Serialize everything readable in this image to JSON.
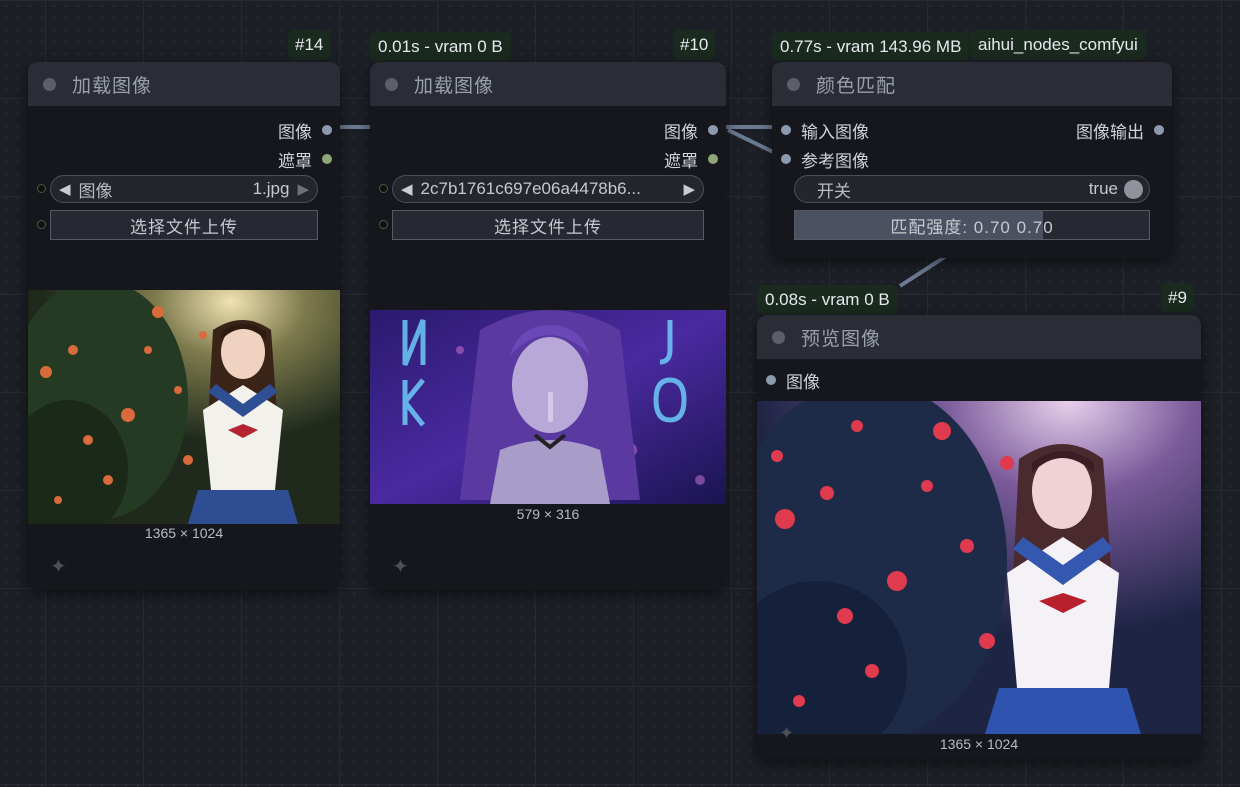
{
  "nodes": {
    "load1": {
      "id": "#14",
      "title": "加载图像",
      "outputs": [
        "图像",
        "遮罩"
      ],
      "combo_label": "图像",
      "combo_value": "1.jpg",
      "upload_button": "选择文件上传",
      "dims": "1365 × 1024"
    },
    "load2": {
      "id": "#10",
      "timing": "0.01s - vram 0 B",
      "title": "加载图像",
      "outputs": [
        "图像",
        "遮罩"
      ],
      "combo_value": "2c7b1761c697e06a4478b6...",
      "upload_button": "选择文件上传",
      "dims": "579 × 316"
    },
    "color_match": {
      "timing": "0.77s - vram 143.96 MB",
      "source": "aihui_nodes_comfyui",
      "title": "颜色匹配",
      "inputs": [
        "输入图像",
        "参考图像"
      ],
      "output": "图像输出",
      "toggle_label": "开关",
      "toggle_value": "true",
      "strength_label": "匹配强度: 0.70  0.70",
      "strength_fraction": 0.7
    },
    "preview": {
      "id": "#9",
      "timing": "0.08s - vram 0 B",
      "title": "预览图像",
      "input": "图像",
      "dims": "1365 × 1024"
    }
  },
  "icons": {
    "sparkle": "sparkle-icon",
    "arrow_left": "◀",
    "arrow_right": "▶"
  },
  "colors": {
    "image_slot": "#8c9ab0",
    "mask_slot": "#8ea67a",
    "badge_bg": "#1a2a1e"
  }
}
